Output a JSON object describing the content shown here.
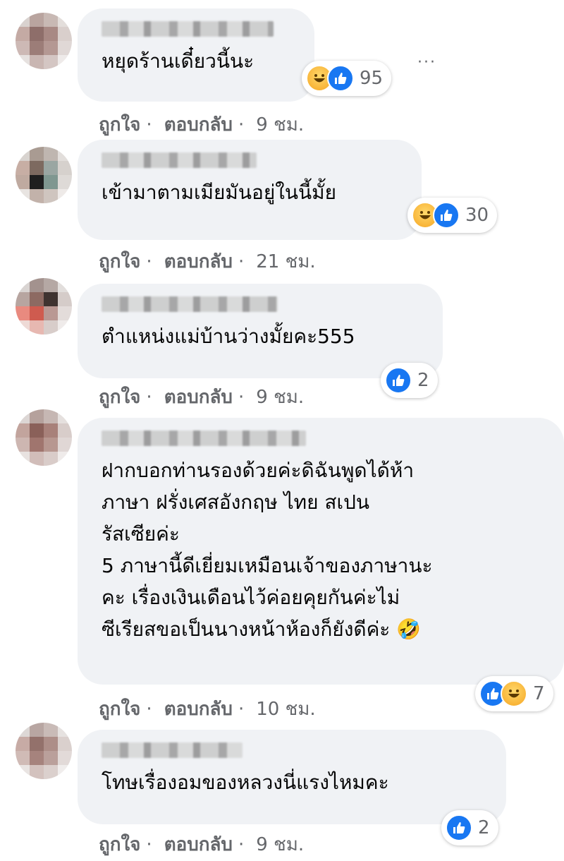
{
  "labels": {
    "like": "ถูกใจ",
    "reply": "ตอบกลับ",
    "dot": "·",
    "more": "···"
  },
  "colors": {
    "bubble": "#f0f2f5",
    "meta": "#65676b",
    "like_blue": "#1877f2"
  },
  "comments": [
    {
      "text": "หยุดร้านเดี๋ยวนี้นะ",
      "reactions": [
        "haha-icon",
        "like-icon"
      ],
      "count": "95",
      "time": "9 ชม."
    },
    {
      "text": "เข้ามาตามเมียมันอยู่ในนี้มั้ย",
      "reactions": [
        "haha-icon",
        "like-icon"
      ],
      "count": "30",
      "time": "21 ชม."
    },
    {
      "text": "ตำแหน่งแม่บ้านว่างมั้ยคะ555",
      "reactions": [
        "like-icon"
      ],
      "count": "2",
      "time": "9 ชม."
    },
    {
      "text": "ฝากบอกท่านรองด้วยค่ะดิฉันพูดได้ห้า\nภาษา ฝรั่งเศสอังกฤษ ไทย สเปน\nรัสเซียค่ะ\n5 ภาษานี้ดีเยี่ยมเหมือนเจ้าของภาษานะ\nคะ เรื่องเงินเดือนไว้ค่อยคุยกันค่ะไม่\nซีเรียสขอเป็นนางหน้าห้องก็ยังดีค่ะ 🤣",
      "reactions": [
        "like-icon",
        "haha-icon"
      ],
      "count": "7",
      "time": "10 ชม."
    },
    {
      "text": "โทษเรื่องอมของหลวงนี่แรงไหมคะ",
      "reactions": [
        "like-icon"
      ],
      "count": "2",
      "time": "9 ชม."
    }
  ]
}
